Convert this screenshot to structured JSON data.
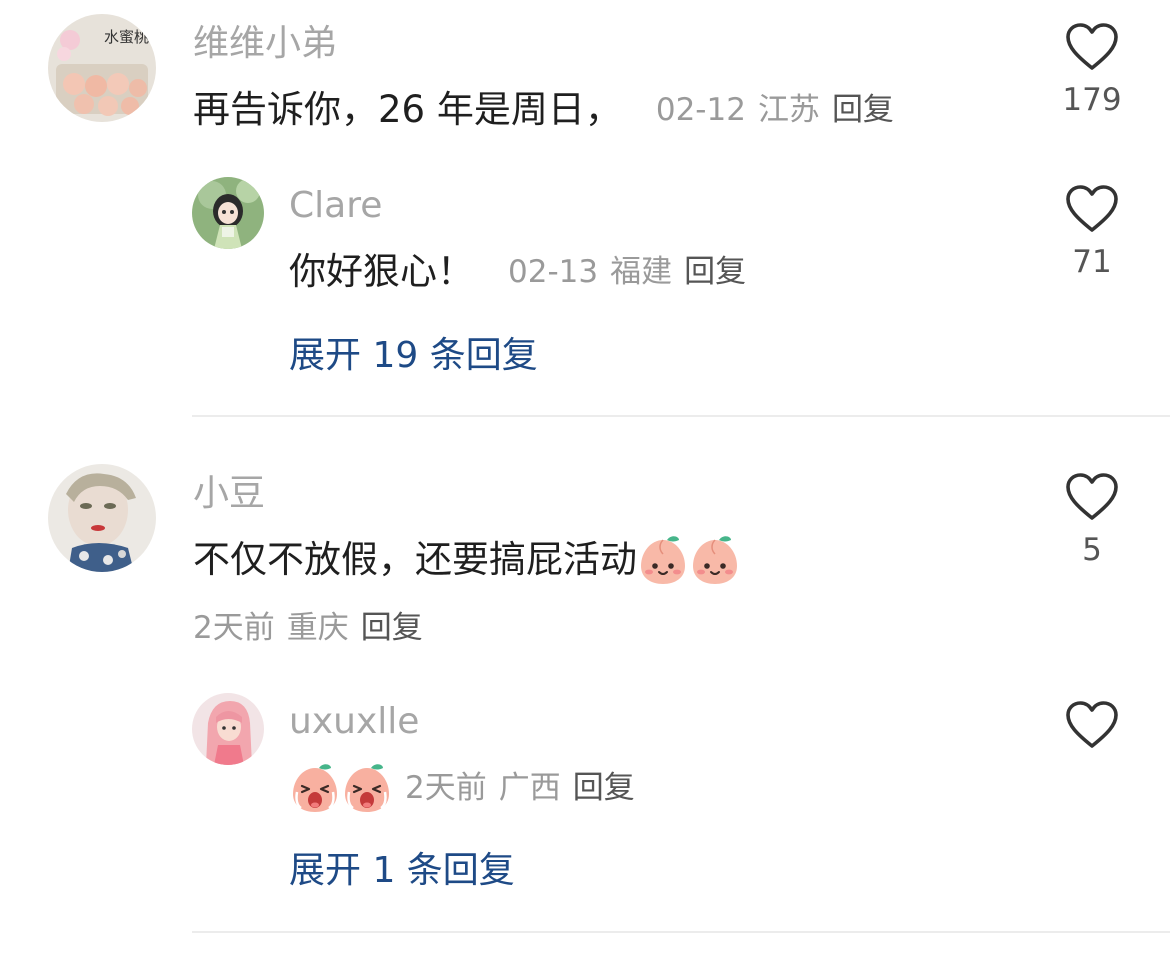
{
  "comments": [
    {
      "username": "维维小弟",
      "text": "再告诉你，26 年是周日，",
      "date": "02-12",
      "location": "江苏",
      "reply_label": "回复",
      "likes": "179",
      "avatar_text": "水蜜桃",
      "replies": [
        {
          "username": "Clare",
          "text": "你好狠心！",
          "date": "02-13",
          "location": "福建",
          "reply_label": "回复",
          "likes": "71"
        }
      ],
      "expand_label": "展开 19 条回复"
    },
    {
      "username": "小豆",
      "text": "不仅不放假，还要搞屁活动",
      "emojis": [
        "peach-smile-emoji",
        "peach-smile-emoji"
      ],
      "date": "2天前",
      "location": "重庆",
      "reply_label": "回复",
      "likes": "5",
      "replies": [
        {
          "username": "uxuxlle",
          "emojis": [
            "peach-crying-emoji",
            "peach-crying-emoji"
          ],
          "date": "2天前",
          "location": "广西",
          "reply_label": "回复",
          "likes": ""
        }
      ],
      "expand_label": "展开 1 条回复"
    }
  ],
  "colors": {
    "username": "#a6a6a6",
    "meta": "#9a9a9a",
    "expand_link": "#1e4a86",
    "divider": "#ececec"
  }
}
